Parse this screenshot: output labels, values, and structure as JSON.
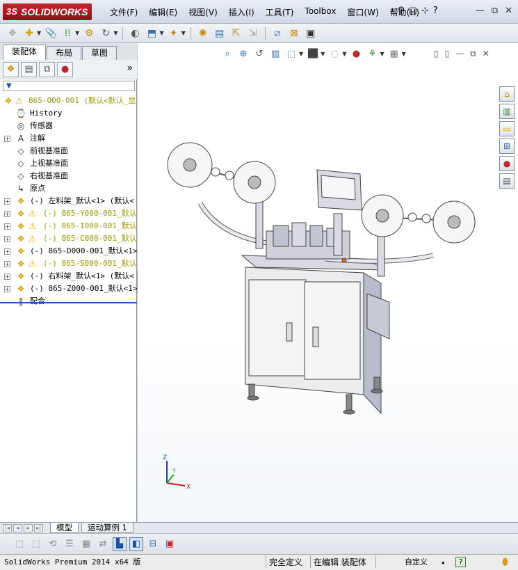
{
  "app": {
    "logo_prefix": "3S",
    "logo_text": "SOLIDWORKS"
  },
  "menu": [
    "文件(F)",
    "编辑(E)",
    "视图(V)",
    "插入(I)",
    "工具(T)",
    "Toolbox",
    "窗口(W)",
    "帮助(H)"
  ],
  "title_icons": [
    "pin-icon",
    "new-doc-icon",
    "search-icon",
    "help-icon"
  ],
  "title_icon_glyphs": [
    "⚲",
    "▢",
    "⊹",
    "?"
  ],
  "window_controls": [
    "—",
    "⧉",
    "✕"
  ],
  "panel": {
    "tabs": [
      "装配体",
      "布局",
      "草图"
    ],
    "expand_glyph": "»",
    "filter_glyph": "▼"
  },
  "tree": {
    "root": {
      "label": "865-000-001  (默认<默认_显",
      "warning": true
    },
    "items": [
      {
        "label": "History",
        "expandable": false,
        "icon": "history-icon",
        "glyph": "⌚",
        "warning": false,
        "color": "#000"
      },
      {
        "label": "传感器",
        "expandable": false,
        "icon": "sensor-icon",
        "glyph": "◎",
        "warning": false,
        "color": "#000"
      },
      {
        "label": "注解",
        "expandable": true,
        "icon": "annotation-icon",
        "glyph": "A",
        "warning": false,
        "color": "#000"
      },
      {
        "label": "前视基准面",
        "expandable": false,
        "icon": "plane-icon",
        "glyph": "◇",
        "warning": false,
        "color": "#000"
      },
      {
        "label": "上视基准面",
        "expandable": false,
        "icon": "plane-icon",
        "glyph": "◇",
        "warning": false,
        "color": "#000"
      },
      {
        "label": "右视基准面",
        "expandable": false,
        "icon": "plane-icon",
        "glyph": "◇",
        "warning": false,
        "color": "#000"
      },
      {
        "label": "原点",
        "expandable": false,
        "icon": "origin-icon",
        "glyph": "↳",
        "warning": false,
        "color": "#000"
      },
      {
        "label": "(-) 左料架_默认<1> (默认<",
        "expandable": true,
        "icon": "part-icon",
        "glyph": "❖",
        "warning": false,
        "color": "#000"
      },
      {
        "label": "(-) 865-Y000-001_默认<1",
        "expandable": true,
        "icon": "part-icon",
        "glyph": "❖",
        "warning": true,
        "color": "#9a9a00"
      },
      {
        "label": "(-) 865-I000-001_默认<1",
        "expandable": true,
        "icon": "part-icon",
        "glyph": "❖",
        "warning": true,
        "color": "#9a9a00"
      },
      {
        "label": "(-) 865-C000-001_默认<1",
        "expandable": true,
        "icon": "part-icon",
        "glyph": "❖",
        "warning": true,
        "color": "#9a9a00"
      },
      {
        "label": "(-) 865-D000-001_默认<1>",
        "expandable": true,
        "icon": "part-icon",
        "glyph": "❖",
        "warning": false,
        "color": "#000"
      },
      {
        "label": "(-) 865-S000-001_默认<1",
        "expandable": true,
        "icon": "part-icon",
        "glyph": "❖",
        "warning": true,
        "color": "#9a9a00"
      },
      {
        "label": "(-) 右料架_默认<1> (默认<",
        "expandable": true,
        "icon": "part-icon",
        "glyph": "❖",
        "warning": false,
        "color": "#000"
      },
      {
        "label": "(-) 865-Z000-001_默认<1>",
        "expandable": true,
        "icon": "part-icon",
        "glyph": "❖",
        "warning": false,
        "color": "#000"
      },
      {
        "label": "配合",
        "expandable": false,
        "icon": "mates-icon",
        "glyph": "∥",
        "warning": false,
        "color": "#000"
      }
    ]
  },
  "bottom_tabs": [
    "模型",
    "运动算例 1"
  ],
  "status": {
    "app": "SolidWorks Premium 2014 x64 版",
    "definition": "完全定义",
    "editing": "在编辑 装配体",
    "custom": "自定义",
    "help_glyph": "?"
  },
  "triad": {
    "x": "X",
    "y": "Y",
    "z": "Z"
  },
  "colors": {
    "accent": "#1f5fbf",
    "warning": "#e8b400",
    "logo": "#b41f25"
  }
}
